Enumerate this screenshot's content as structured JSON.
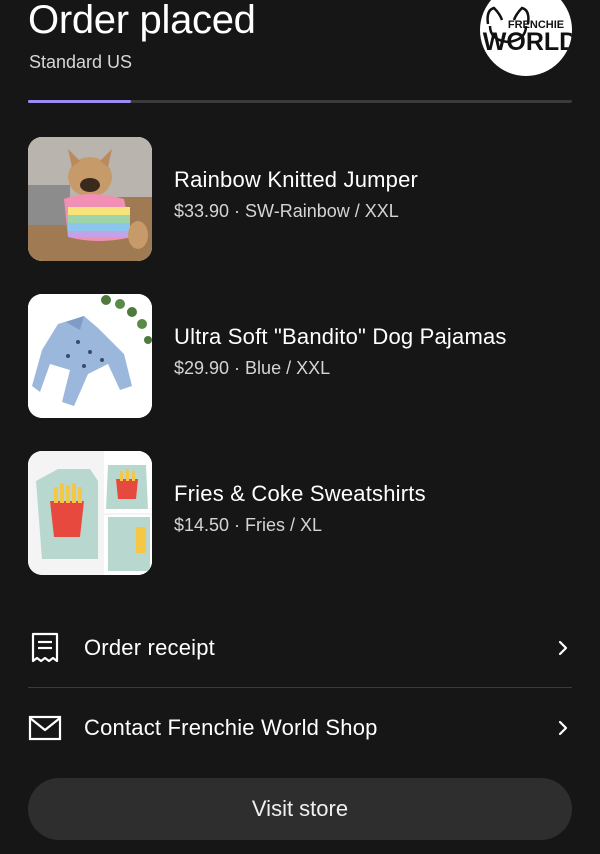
{
  "header": {
    "title": "Order placed",
    "subtitle": "Standard US",
    "logo_text_top": "FRENCHIE",
    "logo_text_bottom": "WORLD"
  },
  "progress": {
    "fraction": 0.19,
    "fill_color": "#9b8cf5"
  },
  "items": [
    {
      "name": "Rainbow Knitted Jumper",
      "meta": "$33.90 · SW-Rainbow / XXL"
    },
    {
      "name": "Ultra Soft \"Bandito\" Dog Pajamas",
      "meta": "$29.90 · Blue / XXL"
    },
    {
      "name": "Fries & Coke Sweatshirts",
      "meta": "$14.50 · Fries / XL"
    }
  ],
  "actions": {
    "receipt_label": "Order receipt",
    "contact_label": "Contact Frenchie World Shop",
    "visit_label": "Visit store"
  },
  "icons": {
    "receipt": "receipt-icon",
    "contact": "envelope-icon",
    "chevron": "chevron-right-icon"
  },
  "colors": {
    "background": "#161616",
    "button": "#2e2e2e",
    "accent": "#9b8cf5"
  }
}
